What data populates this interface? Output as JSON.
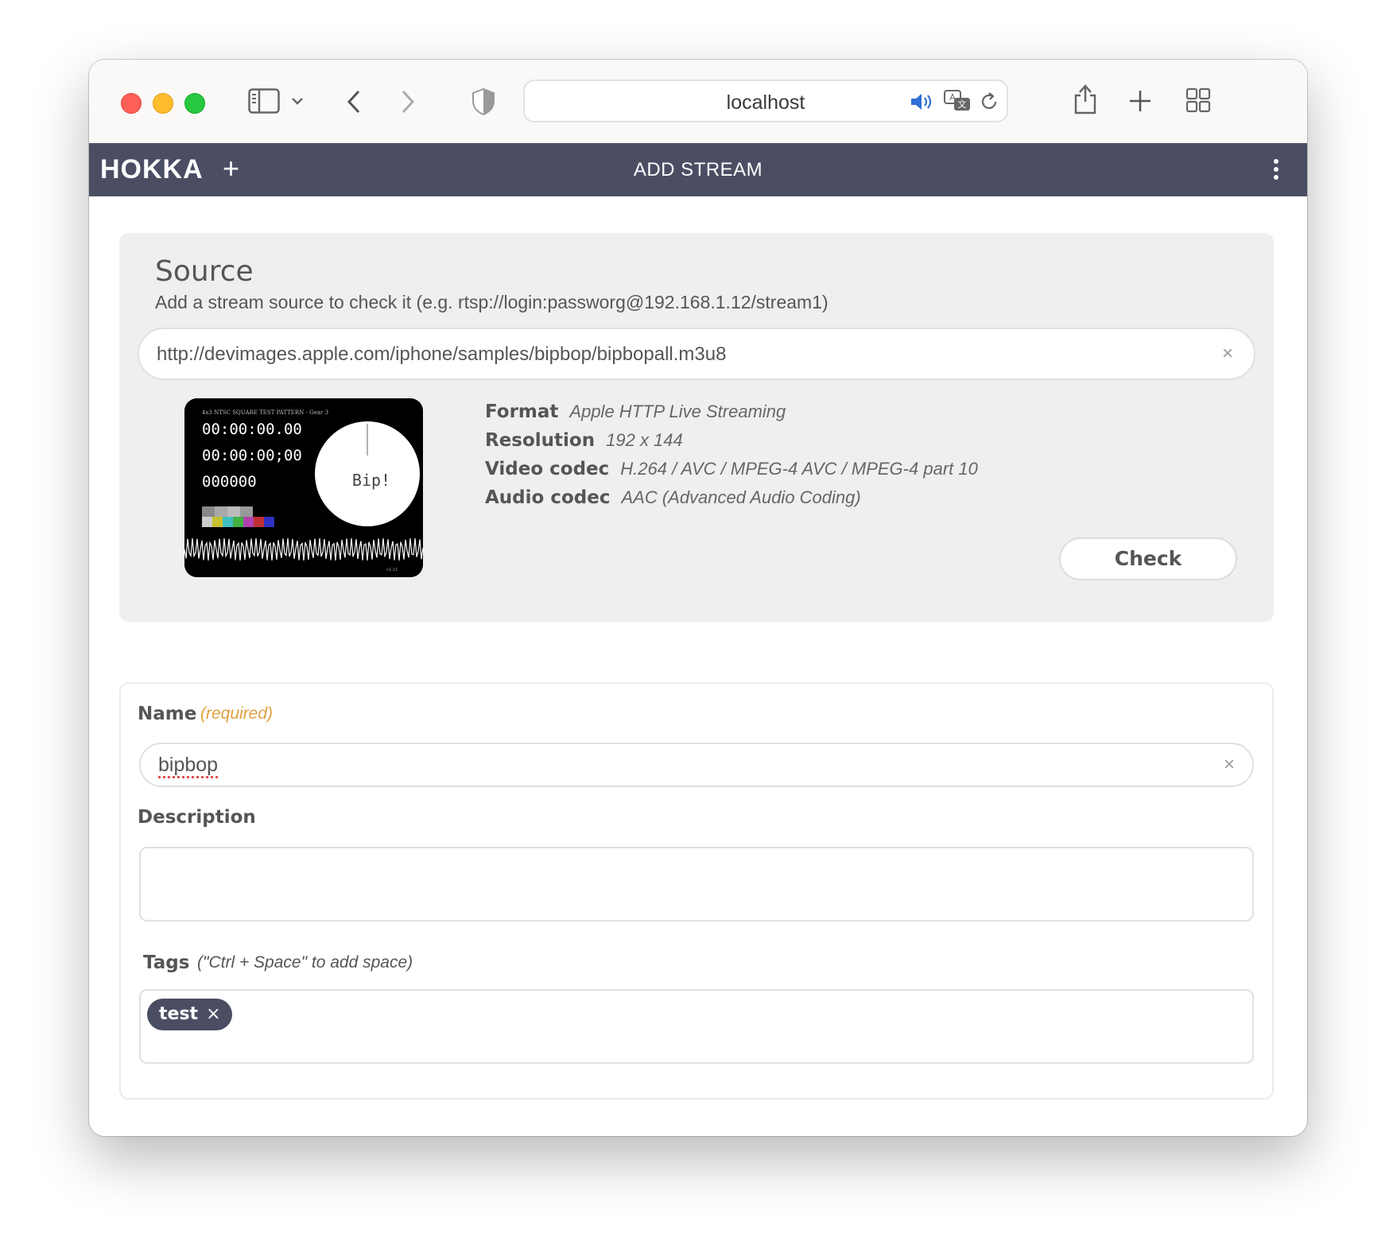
{
  "browser": {
    "url": "localhost"
  },
  "app": {
    "logo": "HOKKA",
    "add_label": "+",
    "title": "ADD STREAM"
  },
  "source": {
    "heading": "Source",
    "hint": "Add a stream source to check it (e.g. rtsp://login:passworg@192.168.1.12/stream1)",
    "url_value": "http://devimages.apple.com/iphone/samples/bipbop/bipbopall.m3u8",
    "clear_label": "×",
    "thumbnail": {
      "caption": "4x3 NTSC SQUARE TEST PATTERN - Gear 3",
      "timecode1": "00:00:00.00",
      "timecode2": "00:00:00;00",
      "counter": "000000",
      "bip": "Bip!"
    },
    "meta": [
      {
        "key": "Format",
        "value": "Apple HTTP Live Streaming"
      },
      {
        "key": "Resolution",
        "value": "192 x 144"
      },
      {
        "key": "Video codec",
        "value": "H.264 / AVC / MPEG-4 AVC / MPEG-4 part 10"
      },
      {
        "key": "Audio codec",
        "value": "AAC (Advanced Audio Coding)"
      }
    ],
    "check_label": "Check"
  },
  "form": {
    "name_label": "Name",
    "name_required": "(required)",
    "name_value": "bipbop",
    "name_clear": "×",
    "description_label": "Description",
    "description_value": "",
    "tags_label": "Tags",
    "tags_hint": "(\"Ctrl + Space\" to add space)",
    "tags": [
      {
        "label": "test",
        "remove": "×"
      }
    ]
  },
  "colors": {
    "header_bg": "#4b4e63",
    "panel_bg": "#eff0ee",
    "required_color": "#e0a040",
    "tag_bg": "#4b4e63"
  }
}
